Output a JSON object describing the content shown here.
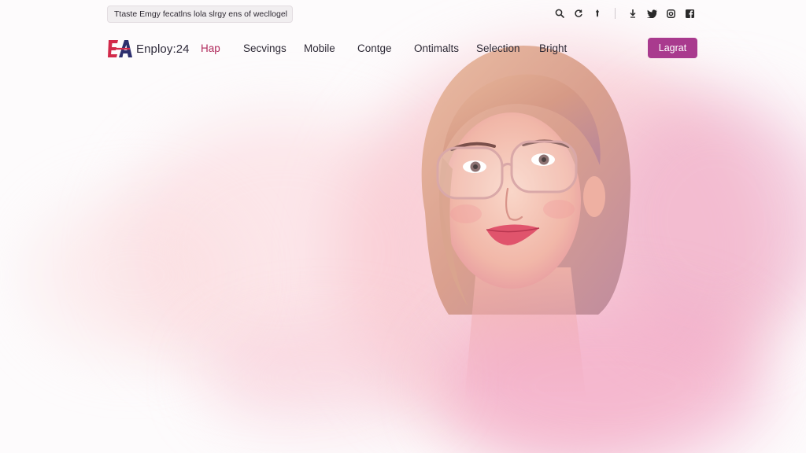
{
  "announcement": {
    "text": "Ttaste Emgy fecatlns lola slrgy ens of wecllogel",
    "chevron": "›"
  },
  "utility_icons": [
    "search-icon",
    "refresh-icon",
    "pin-icon",
    "download-icon",
    "twitter-icon",
    "instagram-icon",
    "facebook-icon"
  ],
  "brand": {
    "mark": "EA",
    "name": "Enploy:24",
    "colors": {
      "mark_red": "#d2294a",
      "mark_navy": "#2d2f6e"
    }
  },
  "nav": {
    "items": [
      {
        "label": "Hap",
        "active": true
      },
      {
        "label": "Secvings",
        "active": false
      },
      {
        "label": "Mobile",
        "active": false
      },
      {
        "label": "Contge",
        "active": false
      },
      {
        "label": "Ontimalts",
        "active": false
      },
      {
        "label": "Selection",
        "active": false
      },
      {
        "label": "Bright",
        "active": false
      }
    ],
    "active_color": "#b02a5c"
  },
  "cta": {
    "label": "Lagrat",
    "color": "#a93a8e"
  },
  "hero": {
    "image": "woman-with-glasses-watercolor-portrait"
  }
}
